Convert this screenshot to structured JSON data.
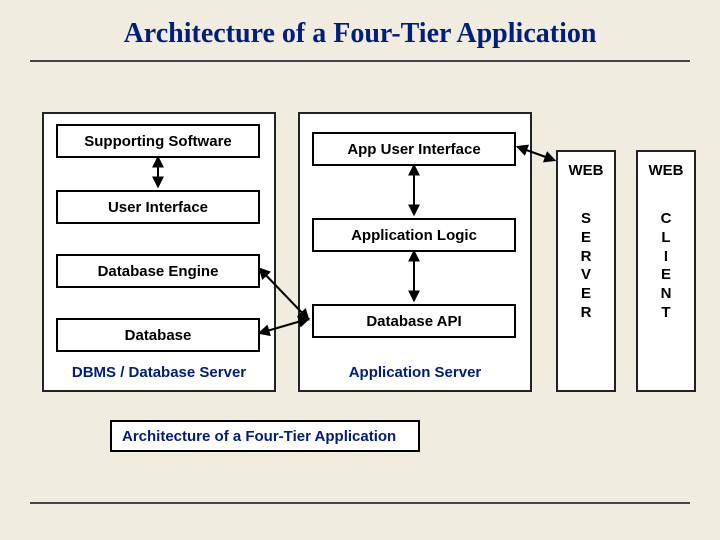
{
  "title": "Architecture of a Four-Tier Application",
  "dbms_panel": {
    "boxes": {
      "supporting_software": "Supporting Software",
      "user_interface": "User Interface",
      "database_engine": "Database Engine",
      "database": "Database"
    },
    "label": "DBMS / Database Server"
  },
  "app_panel": {
    "boxes": {
      "app_ui": "App User Interface",
      "app_logic": "Application Logic",
      "db_api": "Database API"
    },
    "label": "Application Server"
  },
  "web_server": {
    "heading": "WEB",
    "vertical": "SERVER"
  },
  "web_client": {
    "heading": "WEB",
    "vertical": "CLIENT"
  },
  "caption": "Architecture of a Four-Tier Application"
}
